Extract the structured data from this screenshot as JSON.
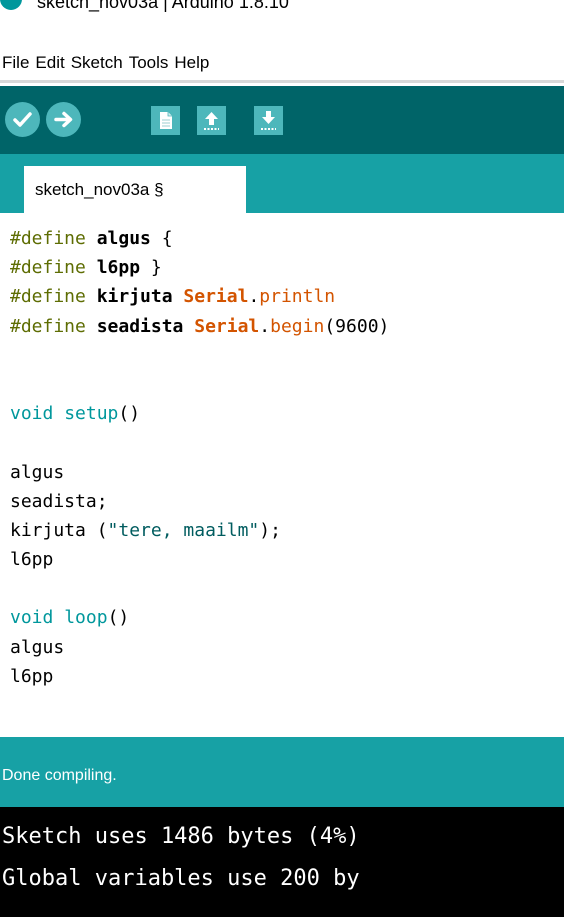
{
  "window": {
    "title": "sketch_nov03a | Arduino 1.8.10"
  },
  "menu": {
    "items": [
      "File",
      "Edit",
      "Sketch",
      "Tools",
      "Help"
    ]
  },
  "toolbar": {
    "buttons": [
      {
        "name": "verify",
        "icon": "checkmark-icon"
      },
      {
        "name": "upload",
        "icon": "arrow-right-icon"
      },
      {
        "name": "new",
        "icon": "document-icon"
      },
      {
        "name": "open",
        "icon": "arrow-up-icon"
      },
      {
        "name": "save",
        "icon": "arrow-down-icon"
      }
    ]
  },
  "colors": {
    "toolbar": "#006468",
    "tab_bar": "#17a1a5",
    "button": "#4db7bb",
    "keyword": "#00979c",
    "preprocessor": "#5e6d03",
    "builtin": "#d35400"
  },
  "tab": {
    "label": "sketch_nov03a §"
  },
  "editor": {
    "lines": [
      "#define algus {",
      "#define l6pp }",
      "#define kirjuta Serial.println",
      "#define seadista Serial.begin(9600)",
      "",
      "",
      "void setup()",
      "",
      "algus",
      "seadista;",
      "kirjuta (\"tere, maailm\");",
      "l6pp",
      "",
      "void loop()",
      "algus",
      "l6pp"
    ]
  },
  "status": {
    "message": "Done compiling."
  },
  "console": {
    "lines": [
      "Sketch uses 1486 bytes (4%)",
      "Global variables use 200 by"
    ]
  }
}
